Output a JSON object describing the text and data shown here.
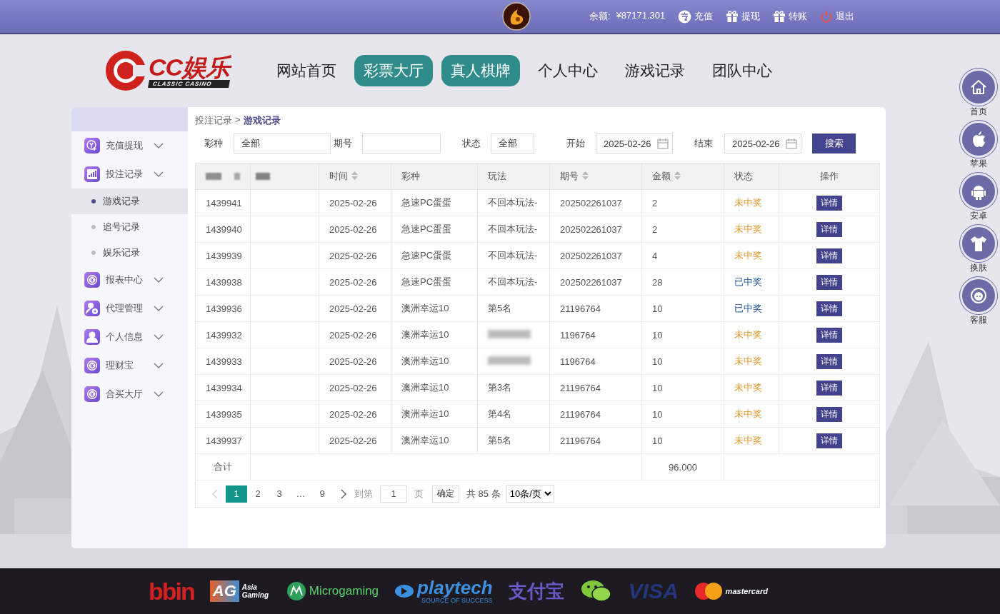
{
  "top_bar": {
    "balance_label": "余额:",
    "balance": "¥87171.301",
    "actions": [
      {
        "kind": "recharge",
        "label": "充值"
      },
      {
        "kind": "withdraw",
        "label": "提现"
      },
      {
        "kind": "transfer",
        "label": "转账"
      },
      {
        "kind": "logout",
        "label": "退出"
      }
    ]
  },
  "header": {
    "logo_text": "CC娱乐",
    "logo_subtitle": "CLASSIC CASINO",
    "nav": [
      {
        "label": "网站首页",
        "highlighted": false
      },
      {
        "label": "彩票大厅",
        "highlighted": true
      },
      {
        "label": "真人棋牌",
        "highlighted": true
      },
      {
        "label": "个人中心",
        "highlighted": false
      },
      {
        "label": "游戏记录",
        "highlighted": false
      },
      {
        "label": "团队中心",
        "highlighted": false
      }
    ]
  },
  "sidebar": {
    "items": [
      {
        "kind": "recharge",
        "label": "充值提现"
      },
      {
        "kind": "chart",
        "label": "投注记录",
        "children": [
          {
            "label": "游戏记录",
            "selected": true
          },
          {
            "label": "追号记录",
            "selected": false
          },
          {
            "label": "娱乐记录",
            "selected": false
          }
        ]
      },
      {
        "kind": "coin",
        "label": "报表中心"
      },
      {
        "kind": "agent",
        "label": "代理管理"
      },
      {
        "kind": "user",
        "label": "个人信息"
      },
      {
        "kind": "coin",
        "label": "理财宝"
      },
      {
        "kind": "coin",
        "label": "合买大厅"
      }
    ]
  },
  "content": {
    "breadcrumb": [
      "投注记录",
      "游戏记录"
    ],
    "breadcrumb_separator": ">",
    "filters": [
      {
        "kind": "text",
        "label": "彩种",
        "value": "全部"
      },
      {
        "kind": "text",
        "label": "期号"
      },
      {
        "kind": "text",
        "label": "状态",
        "value": "全部"
      },
      {
        "kind": "date",
        "label": "开始",
        "value": "2025-02-26"
      },
      {
        "kind": "date",
        "label": "结束",
        "value": "2025-02-26"
      }
    ],
    "search_button": "搜索",
    "table": {
      "columns": [
        {
          "sortable": false,
          "blurred": true
        },
        {
          "sortable": false
        },
        {
          "label": "时间",
          "sortable": true
        },
        {
          "label": "彩种",
          "sortable": false
        },
        {
          "label": "玩法",
          "sortable": false
        },
        {
          "label": "期号",
          "sortable": true
        },
        {
          "label": "金额",
          "sortable": true
        },
        {
          "label": "状态",
          "sortable": false
        },
        {
          "label": "操作",
          "sortable": false
        }
      ],
      "rows": [
        {
          "id": "1439941",
          "time": "2025-02-26",
          "game": "急速PC蛋蛋",
          "play": "不回本玩法-",
          "issue": "202502261037",
          "amount": "2",
          "status": "未中奖",
          "won": false,
          "action": "详情"
        },
        {
          "id": "1439940",
          "time": "2025-02-26",
          "game": "急速PC蛋蛋",
          "play": "不回本玩法-",
          "issue": "202502261037",
          "amount": "2",
          "status": "未中奖",
          "won": false,
          "action": "详情"
        },
        {
          "id": "1439939",
          "time": "2025-02-26",
          "game": "急速PC蛋蛋",
          "play": "不回本玩法-",
          "issue": "202502261037",
          "amount": "4",
          "status": "未中奖",
          "won": false,
          "action": "详情"
        },
        {
          "id": "1439938",
          "time": "2025-02-26",
          "game": "急速PC蛋蛋",
          "play": "不回本玩法-",
          "issue": "202502261037",
          "amount": "28",
          "status": "已中奖",
          "won": true,
          "action": "详情"
        },
        {
          "id": "1439936",
          "time": "2025-02-26",
          "game": "澳洲幸运10",
          "play": "第5名",
          "issue": "21196764",
          "amount": "10",
          "status": "已中奖",
          "won": true,
          "action": "详情"
        },
        {
          "id": "1439932",
          "time": "2025-02-26",
          "game": "澳洲幸运10",
          "play_blurred": true,
          "issue": "1196764",
          "amount": "10",
          "status": "未中奖",
          "won": false,
          "action": "详情"
        },
        {
          "id": "1439933",
          "time": "2025-02-26",
          "game": "澳洲幸运10",
          "play_blurred": true,
          "issue": "1196764",
          "amount": "10",
          "status": "未中奖",
          "won": false,
          "action": "详情"
        },
        {
          "id": "1439934",
          "time": "2025-02-26",
          "game": "澳洲幸运10",
          "play": "第3名",
          "issue": "21196764",
          "amount": "10",
          "status": "未中奖",
          "won": false,
          "action": "详情"
        },
        {
          "id": "1439935",
          "time": "2025-02-26",
          "game": "澳洲幸运10",
          "play": "第4名",
          "issue": "21196764",
          "amount": "10",
          "status": "未中奖",
          "won": false,
          "action": "详情"
        },
        {
          "id": "1439937",
          "time": "2025-02-26",
          "game": "澳洲幸运10",
          "play": "第5名",
          "issue": "21196764",
          "amount": "10",
          "status": "未中奖",
          "won": false,
          "action": "详情"
        }
      ],
      "total": {
        "label": "合计",
        "amount": "96.000"
      }
    },
    "pagination": {
      "pages": [
        {
          "label": "1",
          "selected": true
        },
        {
          "label": "2",
          "selected": false
        },
        {
          "label": "3",
          "selected": false
        },
        {
          "label": "…",
          "selected": false
        },
        {
          "label": "9",
          "selected": false
        }
      ],
      "goto_label": "到第",
      "goto_value": "1",
      "page_unit": "页",
      "confirm": "确定",
      "total": "共 85 条",
      "page_size": "10条/页"
    }
  },
  "dock": [
    {
      "kind": "home",
      "label": "首页"
    },
    {
      "kind": "apple",
      "label": "苹果"
    },
    {
      "kind": "android",
      "label": "安卓"
    },
    {
      "kind": "shirt",
      "label": "换肤"
    },
    {
      "kind": "support",
      "label": "客服"
    }
  ],
  "footer": {
    "logos": [
      {
        "kind": "bbin",
        "text": "bbin"
      },
      {
        "kind": "ag",
        "text": "AG",
        "sub": "Asia Gaming"
      },
      {
        "kind": "mg",
        "text": "Microgaming"
      },
      {
        "kind": "playtech",
        "text": "playtech",
        "sub": "SOURCE OF SUCCESS"
      },
      {
        "kind": "alipay",
        "text": "支付宝"
      },
      {
        "kind": "wechat"
      },
      {
        "kind": "visa",
        "text": "VISA"
      },
      {
        "kind": "mastercard",
        "text": "mastercard"
      }
    ]
  }
}
